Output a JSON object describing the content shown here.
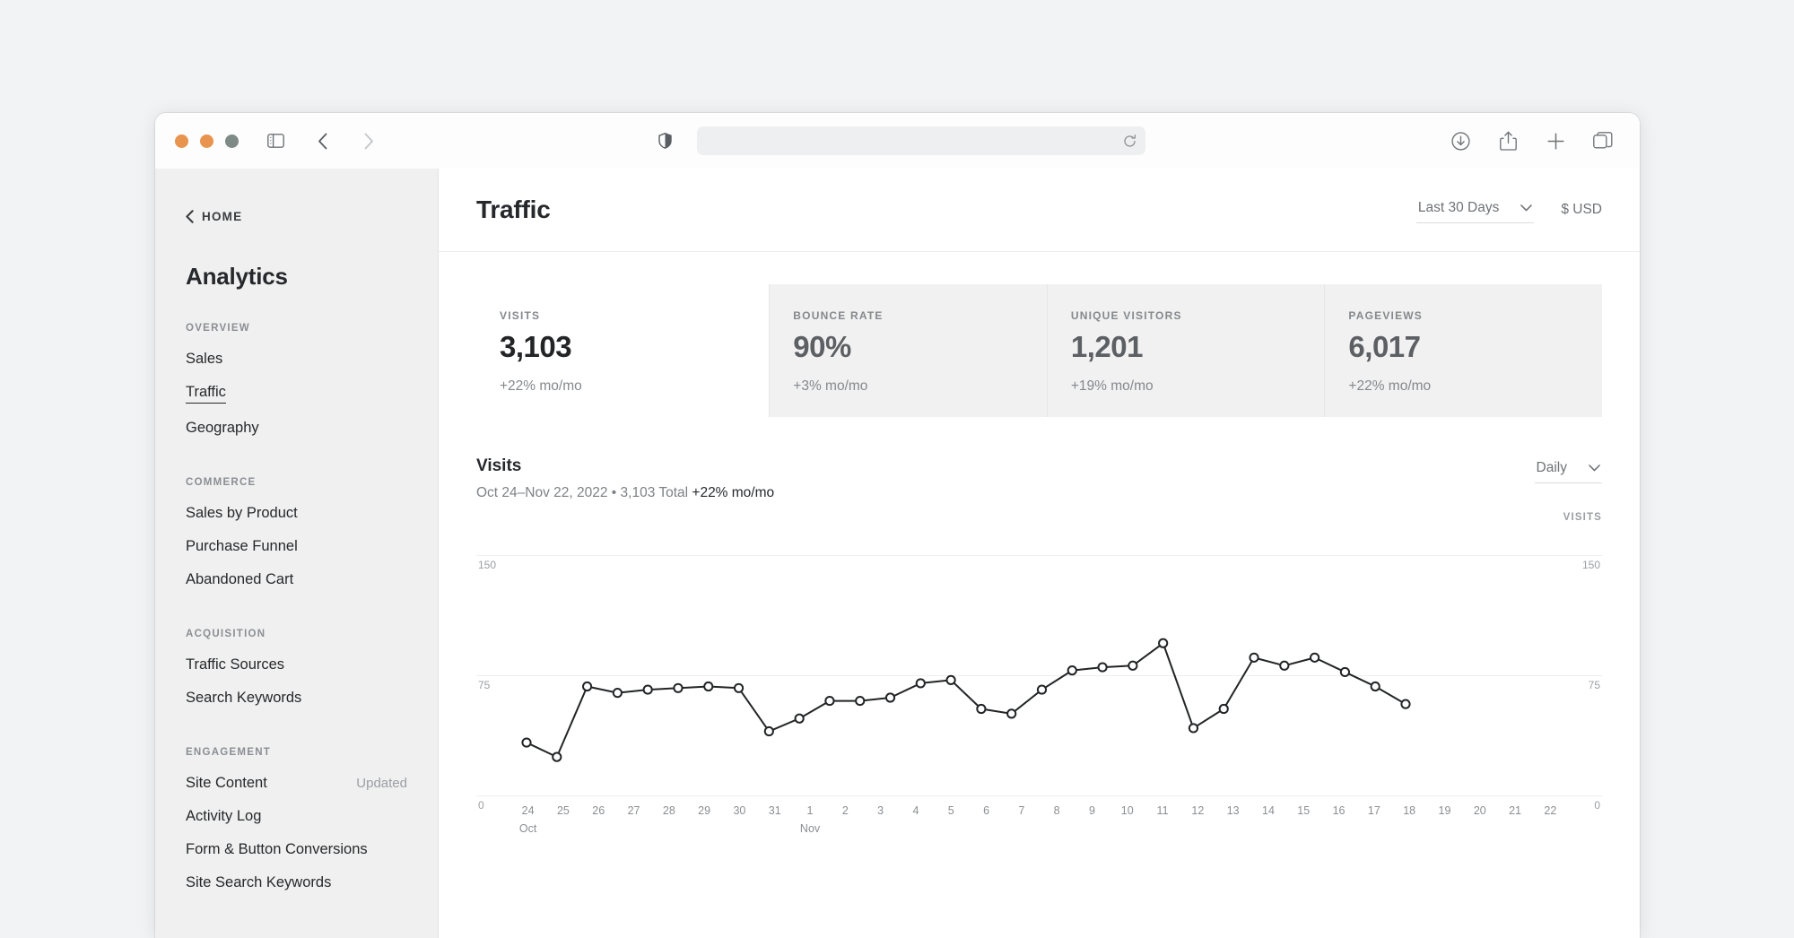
{
  "browser": {
    "traffic_lights": [
      "close",
      "minimize",
      "maximize"
    ],
    "sidebar_toggle_icon": "sidebar-icon",
    "back_icon": "chevron-left-icon",
    "forward_icon": "chevron-right-icon",
    "shield_icon": "shield-icon",
    "address_value": "",
    "address_placeholder": "",
    "reload_icon": "reload-icon",
    "downloads_icon": "download-icon",
    "share_icon": "share-icon",
    "new_tab_icon": "plus-icon",
    "tabs_icon": "tab-overview-icon"
  },
  "sidebar": {
    "home_label": "HOME",
    "home_icon": "chevron-left-icon",
    "title": "Analytics",
    "groups": [
      {
        "label": "OVERVIEW",
        "items": [
          {
            "label": "Sales",
            "active": false,
            "badge": ""
          },
          {
            "label": "Traffic",
            "active": true,
            "badge": ""
          },
          {
            "label": "Geography",
            "active": false,
            "badge": ""
          }
        ]
      },
      {
        "label": "COMMERCE",
        "items": [
          {
            "label": "Sales by Product",
            "active": false,
            "badge": ""
          },
          {
            "label": "Purchase Funnel",
            "active": false,
            "badge": ""
          },
          {
            "label": "Abandoned Cart",
            "active": false,
            "badge": ""
          }
        ]
      },
      {
        "label": "ACQUISITION",
        "items": [
          {
            "label": "Traffic Sources",
            "active": false,
            "badge": ""
          },
          {
            "label": "Search Keywords",
            "active": false,
            "badge": ""
          }
        ]
      },
      {
        "label": "ENGAGEMENT",
        "items": [
          {
            "label": "Site Content",
            "active": false,
            "badge": "Updated"
          },
          {
            "label": "Activity Log",
            "active": false,
            "badge": ""
          },
          {
            "label": "Form & Button Conversions",
            "active": false,
            "badge": ""
          },
          {
            "label": "Site Search Keywords",
            "active": false,
            "badge": ""
          }
        ]
      }
    ]
  },
  "header": {
    "title": "Traffic",
    "date_range": "Last 30 Days",
    "date_range_icon": "chevron-down-icon",
    "currency": "$ USD"
  },
  "kpis": [
    {
      "label": "VISITS",
      "value": "3,103",
      "delta": "+22% mo/mo",
      "active": true
    },
    {
      "label": "BOUNCE RATE",
      "value": "90%",
      "delta": "+3% mo/mo",
      "active": false
    },
    {
      "label": "UNIQUE VISITORS",
      "value": "1,201",
      "delta": "+19% mo/mo",
      "active": false
    },
    {
      "label": "PAGEVIEWS",
      "value": "6,017",
      "delta": "+22% mo/mo",
      "active": false
    }
  ],
  "chart_panel": {
    "title": "Visits",
    "subtitle_plain": "Oct 24–Nov 22, 2022 • 3,103 Total ",
    "subtitle_strong": "+22% mo/mo",
    "granularity": "Daily",
    "granularity_icon": "chevron-down-icon"
  },
  "chart_data": {
    "type": "line",
    "title": "Visits",
    "subtitle": "Oct 24–Nov 22, 2022 • 3,103 Total +22% mo/mo",
    "series_name": "VISITS",
    "ylabel": "VISITS",
    "xlabel": "",
    "ylim": [
      0,
      150
    ],
    "yticks": [
      0,
      75,
      150
    ],
    "grid": true,
    "legend_position": "none",
    "marker": "open-circle",
    "line_color": "#222426",
    "x": [
      "24",
      "25",
      "26",
      "27",
      "28",
      "29",
      "30",
      "31",
      "1",
      "2",
      "3",
      "4",
      "5",
      "6",
      "7",
      "8",
      "9",
      "10",
      "11",
      "12",
      "13",
      "14",
      "15",
      "16",
      "17",
      "18",
      "19",
      "20",
      "21",
      "22"
    ],
    "month_labels": [
      {
        "index": 0,
        "label": "Oct"
      },
      {
        "index": 8,
        "label": "Nov"
      }
    ],
    "values": [
      33,
      24,
      68,
      64,
      66,
      67,
      68,
      67,
      40,
      48,
      59,
      59,
      61,
      70,
      72,
      54,
      51,
      66,
      78,
      80,
      81,
      95,
      42,
      54,
      86,
      81,
      86,
      77,
      68,
      57
    ],
    "total": 3103
  }
}
